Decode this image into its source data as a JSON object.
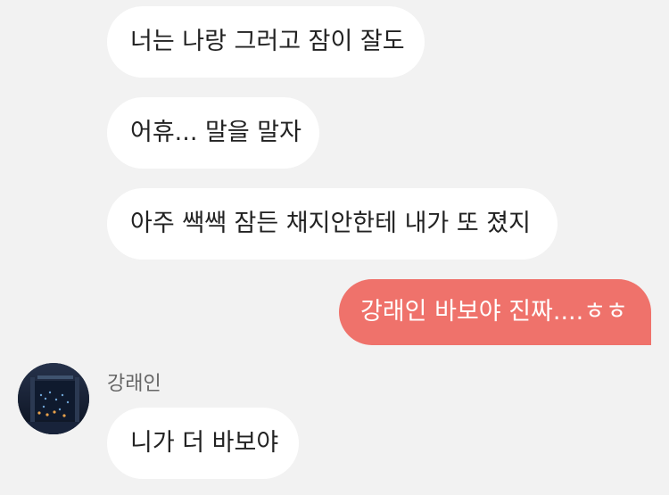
{
  "messages": {
    "m1": "너는 나랑 그러고 잠이 잘도",
    "m2": "어휴... 말을 말자",
    "m3": "아주 쌕쌕 잠든 채지안한테 내가 또 졌지",
    "m4": "강래인 바보야 진짜....ㅎㅎ",
    "m5": "니가 더 바보야"
  },
  "contact": {
    "name": "강래인",
    "avatar_icon": "night-city-photo-icon"
  },
  "colors": {
    "background": "#f2f2f2",
    "incoming_bubble": "#ffffff",
    "outgoing_bubble": "#ef726b"
  }
}
